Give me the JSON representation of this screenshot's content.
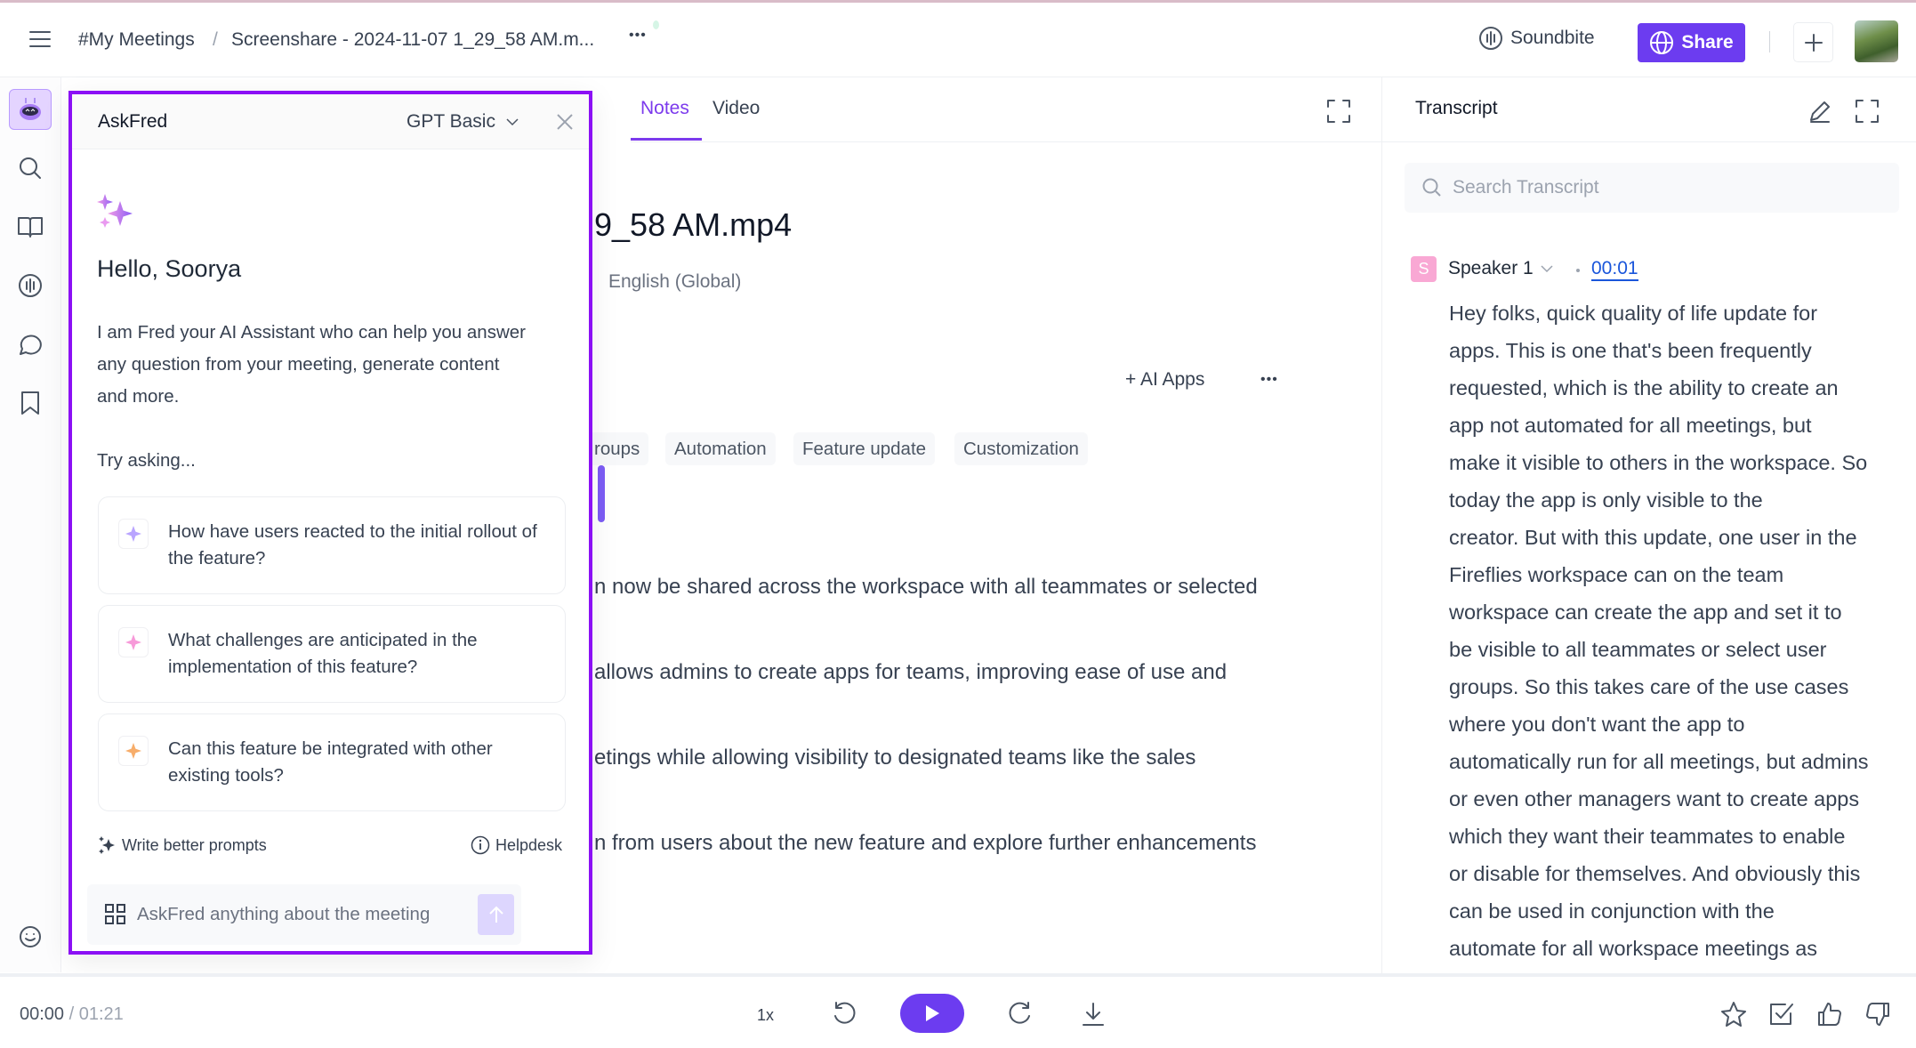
{
  "header": {
    "breadcrumb_root": "#My Meetings",
    "breadcrumb_sep": "/",
    "breadcrumb_current": "Screenshare - 2024-11-07 1_29_58 AM.m...",
    "more": "•••",
    "soundbite_label": "Soundbite",
    "share_label": "Share",
    "accent": "#6c3cf0"
  },
  "sidebar": {
    "items": [
      {
        "icon": "askfred-bot-icon",
        "active": true
      },
      {
        "icon": "search-icon"
      },
      {
        "icon": "book-icon"
      },
      {
        "icon": "soundbite-icon"
      },
      {
        "icon": "chat-icon"
      },
      {
        "icon": "bookmark-icon"
      },
      {
        "icon": "smiley-icon"
      }
    ]
  },
  "askfred": {
    "title": "AskFred",
    "model": "GPT Basic",
    "greeting": "Hello, Soorya",
    "intro_lines": [
      "I am Fred your AI Assistant who can help you answer",
      "any question from your meeting, generate content",
      "and more."
    ],
    "try_asking": "Try asking...",
    "suggestions": [
      {
        "text": "How have users reacted to the initial rollout of the feature?",
        "color": "#b9a4ff"
      },
      {
        "text": "What challenges are anticipated in the implementation of this feature?",
        "color": "#f79ad9"
      },
      {
        "text": "Can this feature be integrated with other existing tools?",
        "color": "#f7ad6a"
      }
    ],
    "write_better_prompts": "Write better prompts",
    "helpdesk": "Helpdesk",
    "input_placeholder": "AskFred anything about the meeting",
    "border_color": "#8b10f5"
  },
  "notes": {
    "tabs": [
      {
        "label": "Notes",
        "active": true
      },
      {
        "label": "Video"
      }
    ],
    "title_fragment": "9_58 AM.mp4",
    "language": "English (Global)",
    "ai_apps": "+ AI Apps",
    "tags": [
      "roups",
      "Automation",
      "Feature update",
      "Customization"
    ],
    "lines": [
      "n now be shared across the workspace with all teammates or selected",
      "allows admins to create apps for teams, improving ease of use and",
      "etings while allowing visibility to designated teams like the sales",
      "n from users about the new feature and explore further enhancements"
    ]
  },
  "transcript": {
    "title": "Transcript",
    "search_placeholder": "Search Transcript",
    "speaker_initial": "S",
    "speaker": "Speaker 1",
    "timestamp": "00:01",
    "lines": [
      "Hey folks, quick quality of life update for",
      "apps. This is one that's been frequently",
      "requested, which is the ability to create an",
      "app not automated for all meetings, but",
      "make it visible to others in the workspace. So",
      "today the app is only visible to the",
      "creator. But with this update, one user in the",
      "Fireflies workspace can on the team",
      "workspace can create the app and set it to",
      "be visible to all teammates or select user",
      "groups. So this takes care of the use cases",
      "where you don't want the app to",
      "automatically run for all meetings, but admins",
      "or even other managers want to create apps",
      "which they want their teammates to enable",
      "or disable for themselves. And obviously this",
      "can be used in conjunction with the",
      "automate for all workspace meetings as"
    ]
  },
  "player": {
    "current": "00:00",
    "sep": "/",
    "duration": "01:21",
    "speed": "1x"
  }
}
